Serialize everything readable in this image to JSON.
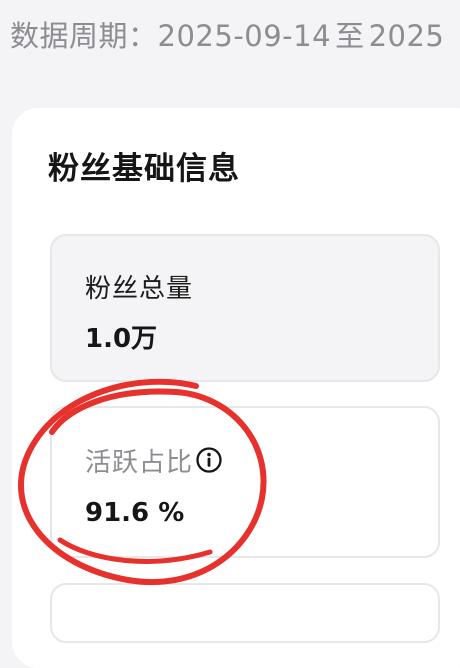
{
  "header": {
    "period_label": "数据周期：",
    "start_date": "2025-09-14",
    "separator": "至",
    "end_date_partial": "2025"
  },
  "section": {
    "title": "粉丝基础信息"
  },
  "stats": [
    {
      "label": "粉丝总量",
      "value": "1.0万"
    },
    {
      "label": "活跃占比",
      "value": "91.6 %"
    }
  ],
  "icons": {
    "active_ratio_info": "info-icon"
  },
  "colors": {
    "annotation_circle": "#e6312c",
    "muted_text": "#8d8d92",
    "primary_text": "#161616"
  }
}
